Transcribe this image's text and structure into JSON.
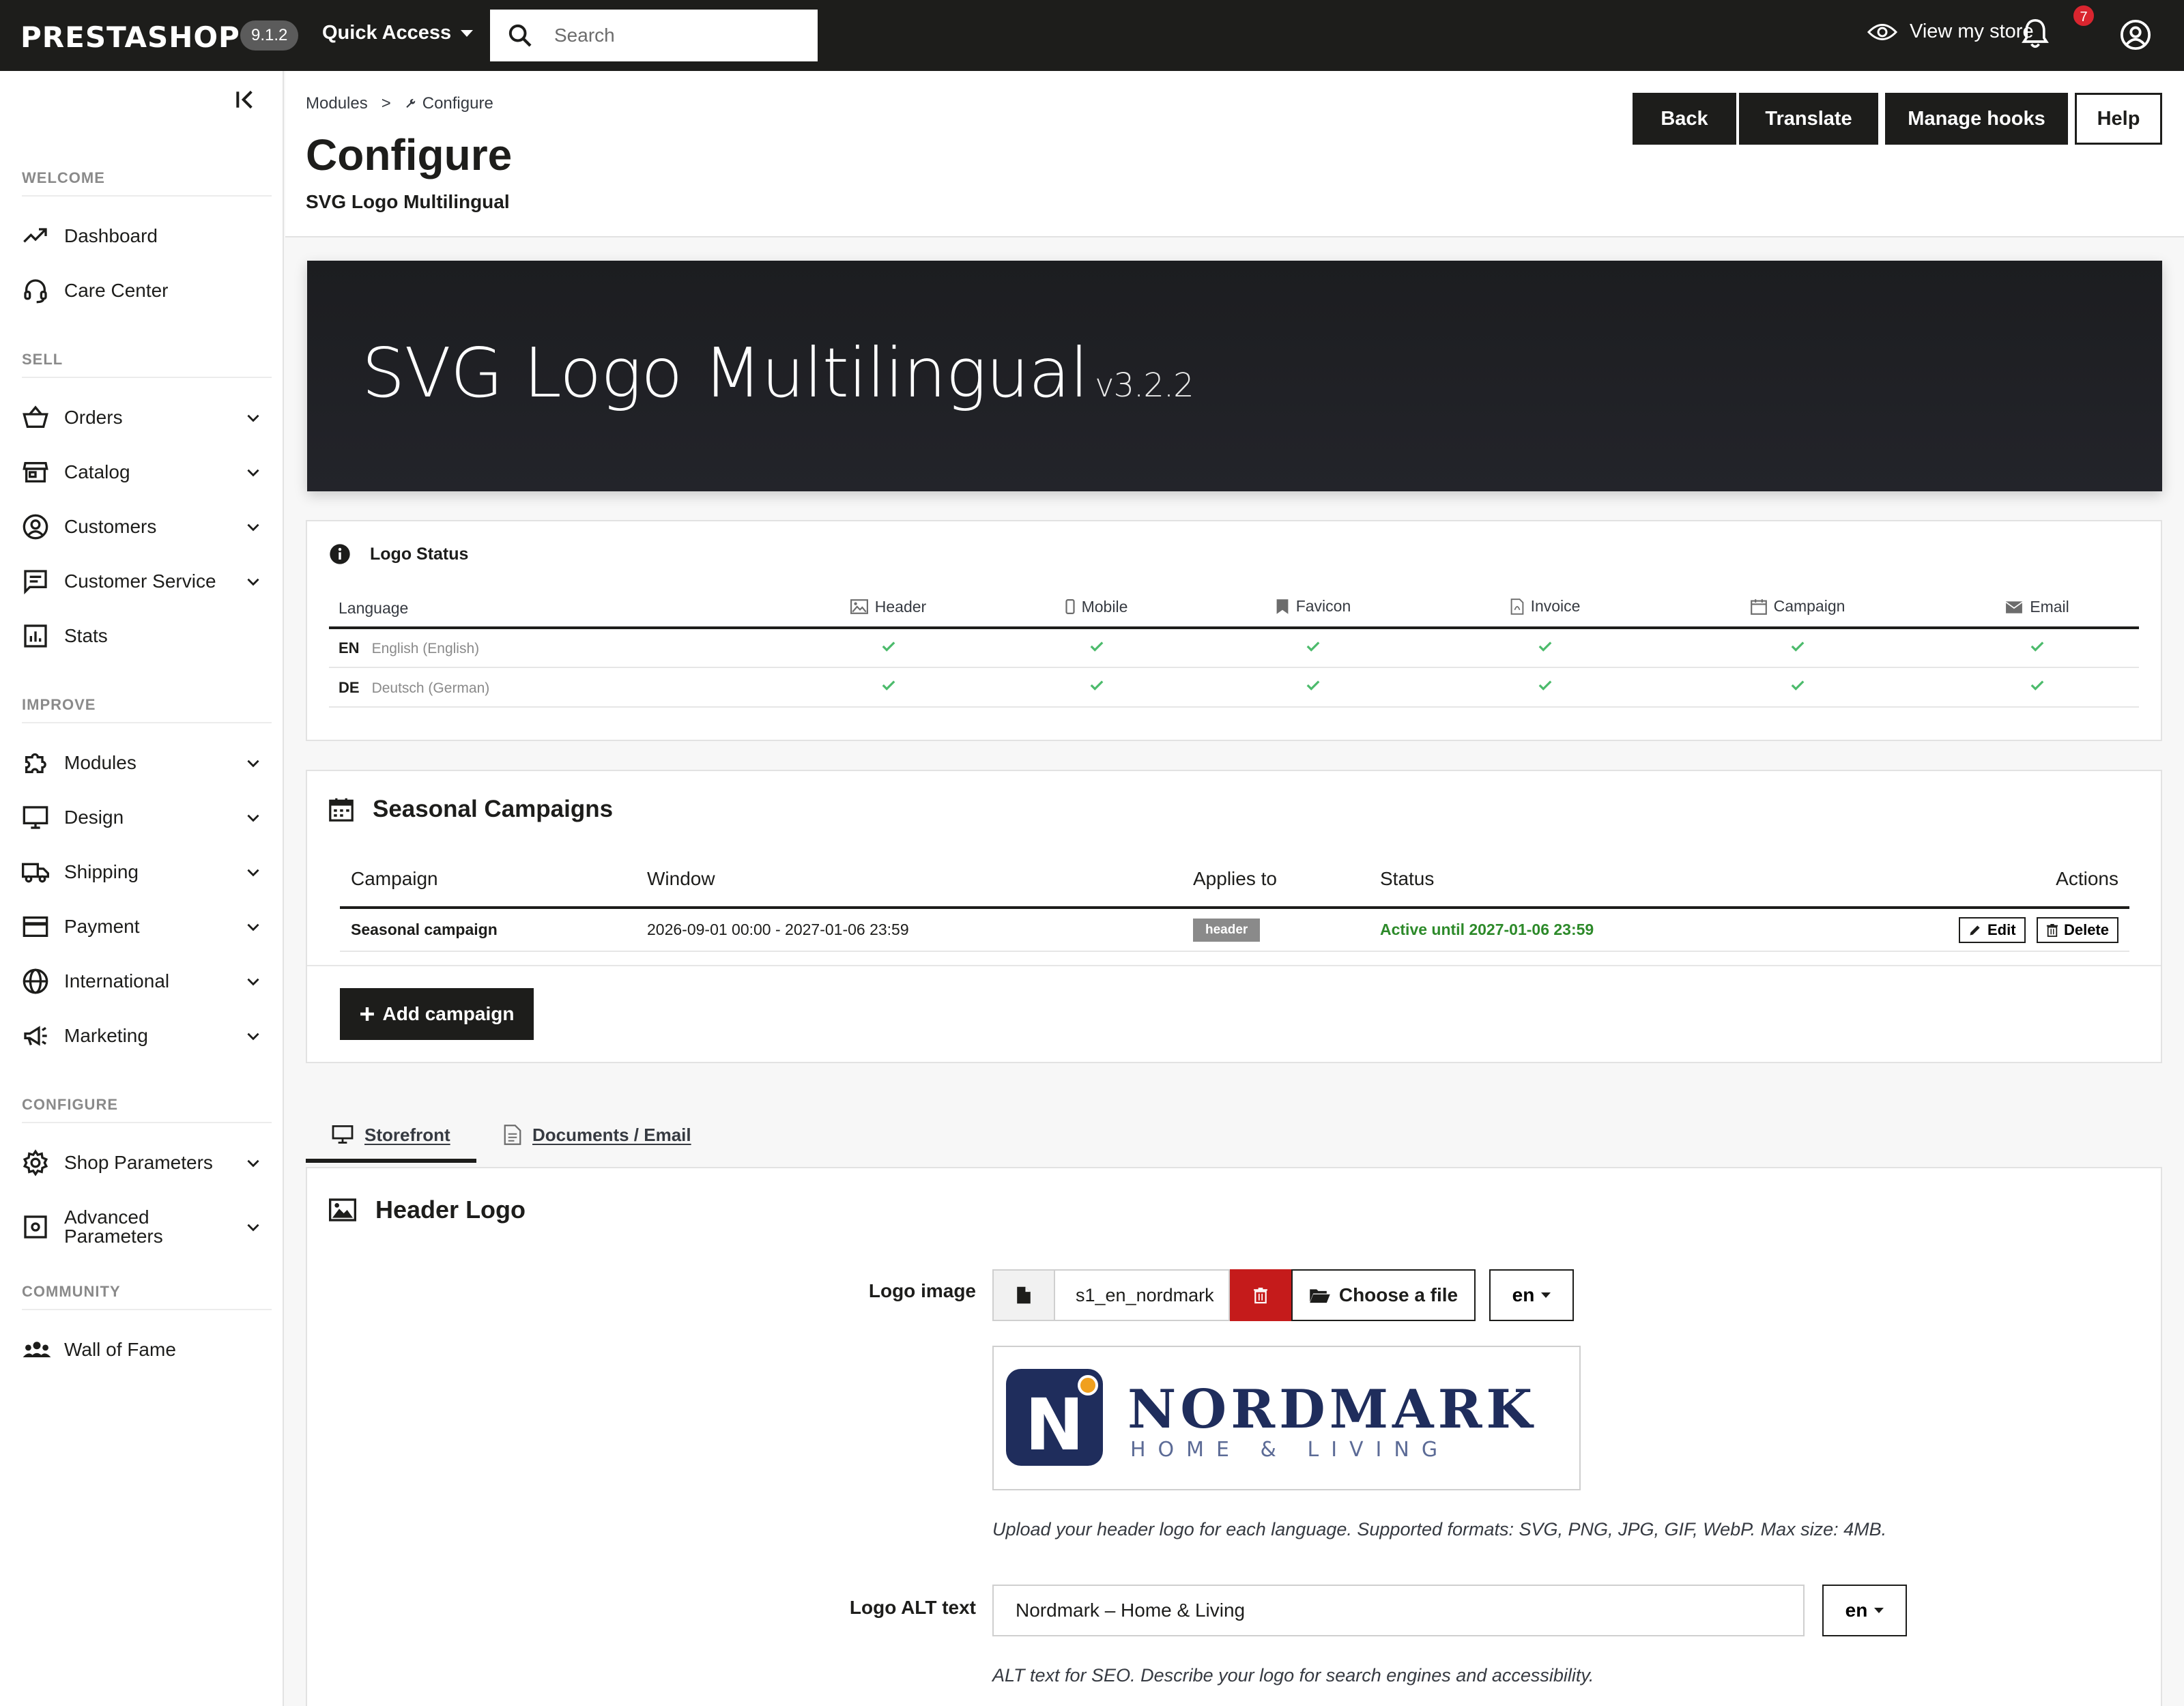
{
  "topbar": {
    "brand": "PRESTASHOP",
    "version": "9.1.2",
    "quick_access": "Quick Access",
    "search_placeholder": "Search",
    "view_store": "View my store",
    "notifications_count": "7"
  },
  "sidebar": {
    "sections": {
      "welcome": "WELCOME",
      "sell": "SELL",
      "improve": "IMPROVE",
      "configure": "CONFIGURE",
      "community": "COMMUNITY"
    },
    "items": {
      "dashboard": "Dashboard",
      "care_center": "Care Center",
      "orders": "Orders",
      "catalog": "Catalog",
      "customers": "Customers",
      "customer_service": "Customer Service",
      "stats": "Stats",
      "modules": "Modules",
      "design": "Design",
      "shipping": "Shipping",
      "payment": "Payment",
      "international": "International",
      "marketing": "Marketing",
      "shop_parameters": "Shop Parameters",
      "advanced_parameters_1": "Advanced",
      "advanced_parameters_2": "Parameters",
      "wall_of_fame": "Wall of Fame"
    }
  },
  "header": {
    "breadcrumb_root": "Modules",
    "breadcrumb_sep": ">",
    "breadcrumb_current": "Configure",
    "title": "Configure",
    "subtitle": "SVG Logo Multilingual",
    "buttons": {
      "back": "Back",
      "translate": "Translate",
      "manage_hooks": "Manage hooks",
      "help": "Help"
    }
  },
  "hero": {
    "title": "SVG Logo Multilingual",
    "version": "v3.2.2"
  },
  "logo_status": {
    "heading": "Logo Status",
    "columns": [
      "Language",
      "Header",
      "Mobile",
      "Favicon",
      "Invoice",
      "Campaign",
      "Email"
    ],
    "rows": [
      {
        "code": "EN",
        "name": "English (English)"
      },
      {
        "code": "DE",
        "name": "Deutsch (German)"
      }
    ]
  },
  "campaigns": {
    "heading": "Seasonal Campaigns",
    "columns": [
      "Campaign",
      "Window",
      "Applies to",
      "Status",
      "Actions"
    ],
    "row": {
      "name": "Seasonal campaign",
      "window": "2026-09-01 00:00 - 2027-01-06 23:59",
      "applies_to": "header",
      "status": "Active until 2027-01-06 23:59",
      "edit": "Edit",
      "delete": "Delete"
    },
    "add_button": "Add campaign"
  },
  "tabs": {
    "storefront": "Storefront",
    "documents_email": "Documents / Email"
  },
  "header_logo": {
    "heading": "Header Logo",
    "logo_image_label": "Logo image",
    "file_name": "s1_en_nordmark",
    "choose_file": "Choose a file",
    "lang": "en",
    "preview_brand": "NORDMARK",
    "preview_tagline": "HOME & LIVING",
    "preview_monogram": "N",
    "upload_help": "Upload your header logo for each language. Supported formats: SVG, PNG, JPG, GIF, WebP. Max size: 4MB.",
    "alt_label": "Logo ALT text",
    "alt_value": "Nordmark – Home & Living",
    "alt_lang": "en",
    "alt_help": "ALT text for SEO. Describe your logo for search engines and accessibility."
  },
  "colors": {
    "dark": "#1d1d1b",
    "danger": "#c51b1b",
    "success": "#2d8a2a",
    "brand_navy": "#1f2d5c",
    "brand_orange": "#f0a01e"
  }
}
